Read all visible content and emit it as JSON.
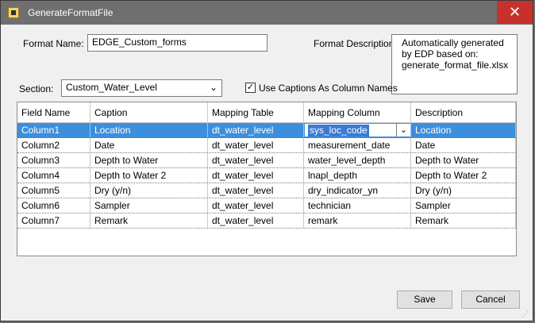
{
  "window": {
    "title": "GenerateFormatFile",
    "close_glyph": "✕",
    "app_icon": "form-app-icon"
  },
  "format_name": {
    "label": "Format Name:",
    "value": "EDGE_Custom_forms"
  },
  "format_description": {
    "label": "Format Description:",
    "value": "Automatically generated by EDP based on: generate_format_file.xlsx"
  },
  "section": {
    "label": "Section:",
    "selected": "Custom_Water_Level"
  },
  "use_captions": {
    "label": "Use Captions As Column Names",
    "checked": true,
    "check_glyph": "✓"
  },
  "grid": {
    "columns": [
      "Field Name",
      "Caption",
      "Mapping Table",
      "Mapping Column",
      "Description"
    ],
    "rows": [
      [
        "Column1",
        "Location",
        "dt_water_level",
        "sys_loc_code",
        "Location"
      ],
      [
        "Column2",
        "Date",
        "dt_water_level",
        "measurement_date",
        "Date"
      ],
      [
        "Column3",
        "Depth to Water",
        "dt_water_level",
        "water_level_depth",
        "Depth to Water"
      ],
      [
        "Column4",
        "Depth to Water 2",
        "dt_water_level",
        "lnapl_depth",
        "Depth to Water 2"
      ],
      [
        "Column5",
        "Dry (y/n)",
        "dt_water_level",
        "dry_indicator_yn",
        "Dry (y/n)"
      ],
      [
        "Column6",
        "Sampler",
        "dt_water_level",
        "technician",
        "Sampler"
      ],
      [
        "Column7",
        "Remark",
        "dt_water_level",
        "remark",
        "Remark"
      ]
    ],
    "selected_row": 0,
    "dropdown_glyph": "⌄"
  },
  "buttons": {
    "save": "Save",
    "cancel": "Cancel"
  },
  "colors": {
    "selection": "#3c8fdd",
    "close": "#c7312b",
    "titlebar": "#6f6f6f"
  }
}
